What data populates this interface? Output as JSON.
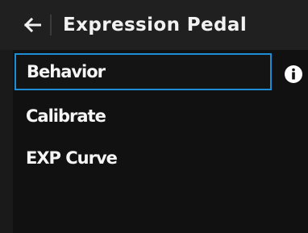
{
  "header": {
    "title": "Expression Pedal",
    "back_icon": "arrow-left-icon"
  },
  "menu": {
    "items": [
      {
        "label": "Behavior",
        "selected": true
      },
      {
        "label": "Calibrate",
        "selected": false
      },
      {
        "label": "EXP Curve",
        "selected": false
      }
    ],
    "info_icon": "info-icon"
  },
  "colors": {
    "accent": "#1d8ed6",
    "background": "#111111",
    "header_background": "#202020",
    "text": "#f5f5f5"
  }
}
